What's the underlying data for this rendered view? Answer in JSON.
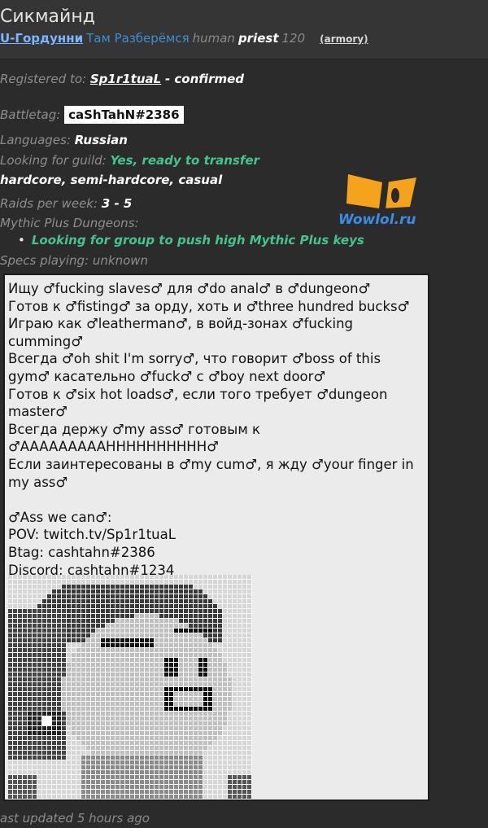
{
  "header": {
    "character_name": "Сикмайнд",
    "realm": "U-Гордунни",
    "guild": "Там Разберёмся",
    "race": "human",
    "class": "priest",
    "level": "120",
    "armory_link": "(armory)"
  },
  "profile": {
    "registered_label": "Registered to:",
    "registered_user": "Sp1r1tuaL",
    "registered_status": "- confirmed",
    "battletag_label": "Battletag:",
    "battletag_value": "caShTahN#2386",
    "languages_label": "Languages:",
    "languages_value": "Russian",
    "guild_label": "Looking for guild:",
    "guild_value": "Yes, ready to transfer",
    "playstyles": "hardcore, semi-hardcore, casual",
    "raids_label": "Raids per week:",
    "raids_value": "3 - 5",
    "mythic_label": "Mythic Plus Dungeons:",
    "mythic_item": "Looking for group to push high Mythic Plus keys",
    "specs_label": "Specs playing:",
    "specs_value": "unknown"
  },
  "description": {
    "lines": [
      "Ищу ♂fucking slaves♂ для ♂do anal♂ в ♂dungeon♂",
      "Готов к ♂fisting♂ за орду, хоть и ♂three hundred bucks♂",
      "Играю как ♂leatherman♂, в войд-зонах ♂fucking",
      "cumming♂",
      "Всегда ♂oh shit I'm sorry♂, что говорит ♂boss of this",
      "gym♂ касательно ♂fuck♂ с ♂boy next door♂",
      "Готов к ♂six hot loads♂, если того требует ♂dungeon",
      "master♂",
      "Всегда держу ♂my ass♂ готовым к",
      "♂AAAAAAAAAHHHHHHHHHH♂",
      "Если заинтересованы в ♂my cum♂, я жду ♂your finger in",
      "my ass♂",
      "",
      "♂Ass we can♂:",
      "POV: twitch.tv/Sp1r1tuaL",
      "Btag: cashtahn#2386",
      "Discord: cashtahn#1234"
    ]
  },
  "footer": {
    "updated_label": "ast updated",
    "updated_value": "5 hours ago"
  },
  "watermark": {
    "text": "Wowlol.ru",
    "colors": {
      "logo_orange": "#f5a21c",
      "logo_dark": "#2a2a2a",
      "text_blue": "#3a8ee6"
    }
  },
  "colors": {
    "background": "#2b2b2b",
    "header_bg": "#353535",
    "green": "#45c490",
    "realm_blue": "#7db6ff",
    "guild_blue": "#3e8fd1",
    "description_bg": "#ebebeb"
  }
}
